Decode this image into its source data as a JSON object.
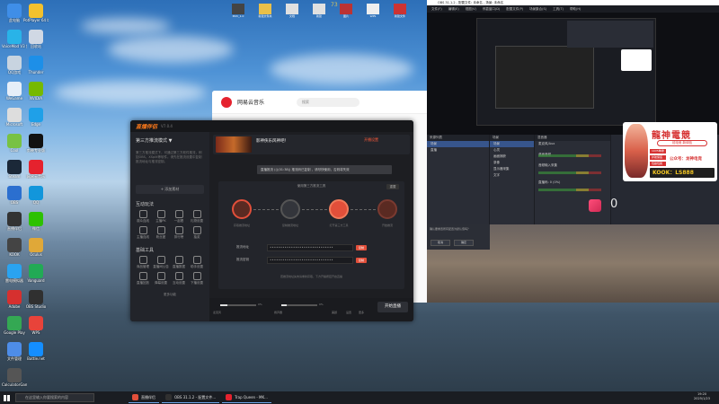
{
  "desktop": {
    "icons": [
      {
        "label": "此电脑",
        "color": "#3f8ee8"
      },
      {
        "label": "PotPlayer 64 bit",
        "color": "#f2c12e"
      },
      {
        "label": "VoiceMod V3 加速器",
        "color": "#29b3e8"
      },
      {
        "label": "回收站",
        "color": "#d0d8e4"
      },
      {
        "label": "QQ游戏",
        "color": "#c8d4e0"
      },
      {
        "label": "Thunder",
        "color": "#1d8fe8"
      },
      {
        "label": "WeGame",
        "color": "#e6eef8"
      },
      {
        "label": "NVIDIA",
        "color": "#76b900"
      },
      {
        "label": "Microsoft",
        "color": "#dddddd"
      },
      {
        "label": "Edge",
        "color": "#1fa0e8"
      },
      {
        "label": "Cool",
        "color": "#78c244"
      },
      {
        "label": "剪映专业版",
        "color": "#111111"
      },
      {
        "label": "Steam",
        "color": "#1b2838"
      },
      {
        "label": "网易云音乐",
        "color": "#e5222e"
      },
      {
        "label": "OBS",
        "color": "#2b6fcf"
      },
      {
        "label": "QQ",
        "color": "#1296db"
      },
      {
        "label": "直播伴侣",
        "color": "#333333"
      },
      {
        "label": "微信",
        "color": "#2dc100"
      },
      {
        "label": "KOOK",
        "color": "#444444"
      },
      {
        "label": "Oculus",
        "color": "#e0a838"
      },
      {
        "label": "雷电模拟器",
        "color": "#2aa3f0"
      },
      {
        "label": "Vanguard",
        "color": "#22aa55"
      },
      {
        "label": "Adobe",
        "color": "#d6302f"
      },
      {
        "label": "OBS Studio",
        "color": "#303030"
      },
      {
        "label": "Google Play",
        "color": "#34a853"
      },
      {
        "label": "WPS",
        "color": "#e8433a"
      },
      {
        "label": "文件管理",
        "color": "#4e8de8"
      },
      {
        "label": "Battle.net",
        "color": "#148eff"
      },
      {
        "label": "CalculatorGame",
        "color": "#555555"
      }
    ],
    "top_strip": [
      {
        "label": "M4V_1.0",
        "color": "#444"
      },
      {
        "label": "新建文件夹",
        "color": "#e9c04a"
      },
      {
        "label": "文档",
        "color": "#e0e0e0"
      },
      {
        "label": "新建",
        "color": "#e0e0e0"
      },
      {
        "label": "图片",
        "color": "#b33"
      },
      {
        "label": "WPS",
        "color": "#eee"
      },
      {
        "label": "新建文件",
        "color": "#c33"
      }
    ],
    "badge_number": "73"
  },
  "music_window": {
    "app_name": "网易云音乐",
    "search_placeholder": "搜索"
  },
  "live_app": {
    "brand": "直播伴侣",
    "version": "V7.0.4",
    "mode_label": "第三方推流模式 ▼",
    "mode_desc": "第三方推流模式下，可通过第三方软件推流，例如OBS、XSplit等软件。请先在推流设置中复制推流地址与推流密钥。",
    "add_material": "+ 添加素材",
    "sections": [
      {
        "title": "互动玩法",
        "items": [
          "观众连线",
          "主播PK",
          "一起看",
          "礼物设置",
          "主播连线",
          "粉丝团",
          "排行榜",
          "抽奖"
        ]
      },
      {
        "title": "基础工具",
        "items": [
          "商品管理",
          "直播间公告",
          "直播数据",
          "助手设置",
          "直播回放",
          "弹幕设置",
          "互动设置",
          "下播设置"
        ]
      }
    ],
    "more_tools": "更多功能",
    "stream_title": "影神侠乐风神吧！",
    "start_live_top": "开播设置",
    "tooltip": "直播推流 ((((01:38)) 推流码已复制 ，请尽快使用，否则将失效",
    "panel_title": "使用第三方推流工具",
    "reset": "重置",
    "steps": [
      "获取推流地址",
      "复制推流地址",
      "打开第三方工具",
      "开始推流"
    ],
    "fields": [
      {
        "label": "推流地址",
        "value": "••••••••••••••••••••••••••••••",
        "btn": "复制"
      },
      {
        "label": "推流密钥",
        "value": "••••••••••••••••••••••••••••••",
        "btn": "复制"
      }
    ],
    "hint": "若推流地址失效请重新获取，下方开播按钮开启直播",
    "start_live": "开始直播",
    "bottom_labels": [
      "麦克风",
      "扬声器",
      "0%",
      "0%",
      "美颜",
      "设置",
      "更多"
    ]
  },
  "obs": {
    "title": "OBS 31.1.2 - 配置文件: 未命名 - 场景: 未命名",
    "menus": [
      "文件(F)",
      "编辑(E)",
      "视图(V)",
      "停靠窗口(D)",
      "配置文件(P)",
      "场景集合(S)",
      "工具(T)",
      "帮助(H)"
    ],
    "docks": [
      {
        "title": "来源列表",
        "rows": [
          "场景",
          "直播"
        ],
        "selected": 0
      },
      {
        "title": "场景",
        "rows": [
          "场景",
          "心灵",
          "画面捕获",
          "录像",
          "显示器采集",
          "文字"
        ],
        "selected": 0
      },
      {
        "title": "混音器",
        "rows": [
          "麦克风/Aux",
          "桌面音频",
          "音频输入采集"
        ],
        "selected": -1
      }
    ],
    "dialog_text": "确认要重置所有配置为默认值吗？",
    "dialog_buttons": [
      "取消",
      "确定"
    ],
    "stat": "直播码: 0 (0%)"
  },
  "ad": {
    "name": "龍神電競",
    "slogan": "炫电竞 新体验",
    "tags": [
      "10V5单排",
      "护航保底",
      "包赢包爽"
    ],
    "wechat": "公众号：龙神电竞",
    "kook": "KOOK：LS888"
  },
  "right_counter": "0",
  "taskbar": {
    "search_placeholder": "在这里输入你要搜索的内容",
    "apps": [
      {
        "label": "直播伴侣",
        "color": "#e24f3a"
      },
      {
        "label": "OBS 31.1.2 - 配置文件...",
        "color": "#303030"
      },
      {
        "label": "Trap Queen - MK...",
        "color": "#e5222e"
      }
    ],
    "time": "19:20",
    "date": "2025/1/23"
  },
  "colors": {
    "accent": "#e24f3a",
    "obs_select": "#37558c",
    "ad_red": "#d63232"
  }
}
